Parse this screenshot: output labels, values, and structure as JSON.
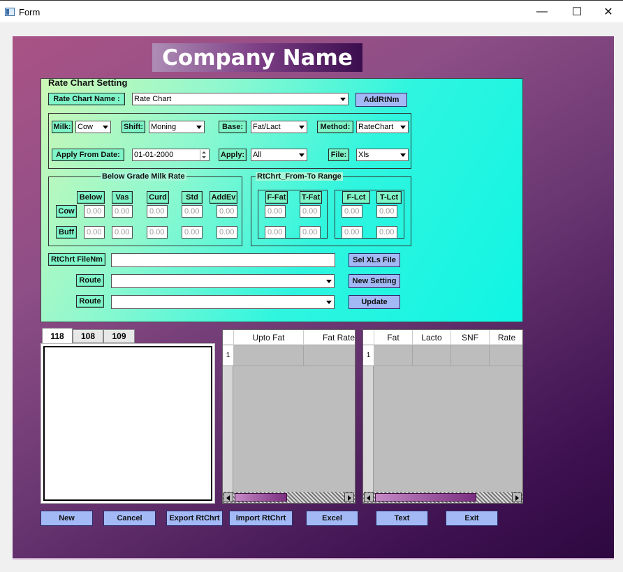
{
  "window": {
    "title": "Form",
    "minimize": "—",
    "maximize": "☐",
    "close": "✕"
  },
  "company_name": "Company Name",
  "rate_chart": {
    "panel_title": "Rate Chart Setting",
    "name_label": "Rate Chart Name :",
    "name_value": "Rate Chart",
    "add_button": "AddRtNm",
    "milk_label": "Milk:",
    "milk_value": "Cow",
    "shift_label": "Shift:",
    "shift_value": "Moning",
    "base_label": "Base:",
    "base_value": "Fat/Lact",
    "method_label": "Method:",
    "method_value": "RateChart",
    "apply_from_label": "Apply From Date:",
    "apply_from_value": "01-01-2000",
    "apply_label": "Apply:",
    "apply_value": "All",
    "file_label": "File:",
    "file_value": "Xls"
  },
  "below_grade": {
    "title": "Below Grade Milk Rate",
    "columns": [
      "Below",
      "Vas",
      "Curd",
      "Std",
      "AddEv"
    ],
    "rows": [
      {
        "label": "Cow",
        "values": [
          "0.00",
          "0.00",
          "0.00",
          "0.00",
          "0.00"
        ]
      },
      {
        "label": "Buff",
        "values": [
          "0.00",
          "0.00",
          "0.00",
          "0.00",
          "0.00"
        ]
      }
    ]
  },
  "range": {
    "title": "RtChrt_From-To Range",
    "fat_cols": [
      "F-Fat",
      "T-Fat"
    ],
    "lct_cols": [
      "F-Lct",
      "T-Lct"
    ],
    "fat_values": [
      "0.00",
      "0.00",
      "0.00",
      "0.00"
    ],
    "lct_values": [
      "0.00",
      "0.00",
      "0.00",
      "0.00"
    ]
  },
  "file_row": {
    "filenm_label": "RtChrt FileNm",
    "filenm_value": "",
    "sel_button": "Sel XLs File",
    "route_label_1": "Route",
    "route_label_2": "Route",
    "new_setting_button": "New Setting",
    "update_button": "Update"
  },
  "tabs": [
    "118",
    "108",
    "109"
  ],
  "grid1": {
    "columns": [
      "Upto Fat",
      "Fat Rate"
    ],
    "row_numbers": [
      "1"
    ]
  },
  "grid2": {
    "columns": [
      "Fat",
      "Lacto",
      "SNF",
      "Rate"
    ],
    "row_numbers": [
      "1"
    ]
  },
  "buttons": [
    "New",
    "Cancel",
    "Export RtChrt",
    "Import RtChrt",
    "Excel",
    "Text",
    "Exit"
  ]
}
